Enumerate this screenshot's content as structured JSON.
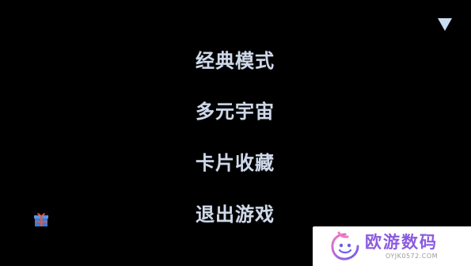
{
  "menu": {
    "items": [
      {
        "label": "经典模式"
      },
      {
        "label": "多元宇宙"
      },
      {
        "label": "卡片收藏"
      },
      {
        "label": "退出游戏"
      }
    ]
  },
  "icons": {
    "top_right": "dropdown-triangle-icon",
    "bottom_left": "gift-icon"
  },
  "watermark": {
    "name": "欧游数码",
    "domain": "OYJK0572.COM"
  },
  "colors": {
    "background": "#000000",
    "menu_text": "#cfd9ea",
    "dropdown_icon": "#c9dcf0",
    "gift_box": "#3d7ad6",
    "gift_ribbon": "#e05a3a",
    "watermark_bg": "#ffffff",
    "watermark_text": "#8a5ce0",
    "watermark_domain": "#9a9a9a"
  }
}
